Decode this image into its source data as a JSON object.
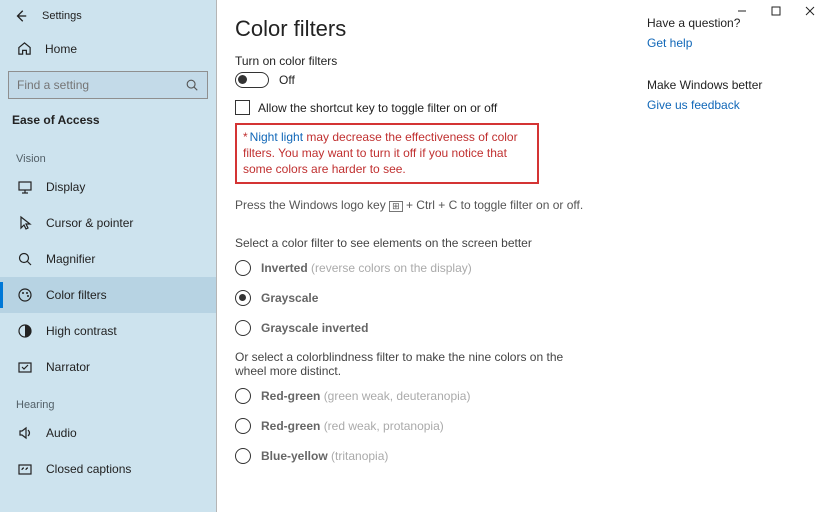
{
  "app": {
    "title": "Settings"
  },
  "sidebar": {
    "home": "Home",
    "search_placeholder": "Find a setting",
    "category": "Ease of Access",
    "sections": [
      {
        "label": "Vision",
        "items": [
          {
            "id": "display",
            "label": "Display",
            "icon": "monitor"
          },
          {
            "id": "cursor-pointer",
            "label": "Cursor & pointer",
            "icon": "cursor"
          },
          {
            "id": "magnifier",
            "label": "Magnifier",
            "icon": "magnify"
          },
          {
            "id": "color-filters",
            "label": "Color filters",
            "icon": "palette",
            "active": true
          },
          {
            "id": "high-contrast",
            "label": "High contrast",
            "icon": "contrast"
          },
          {
            "id": "narrator",
            "label": "Narrator",
            "icon": "narrator"
          }
        ]
      },
      {
        "label": "Hearing",
        "items": [
          {
            "id": "audio",
            "label": "Audio",
            "icon": "speaker"
          },
          {
            "id": "closed-captions",
            "label": "Closed captions",
            "icon": "captions"
          }
        ]
      }
    ]
  },
  "page": {
    "title": "Color filters",
    "toggle_label": "Turn on color filters",
    "toggle_state": "Off",
    "shortcut_check": "Allow the shortcut key to toggle filter on or off",
    "note_asterisk": "*",
    "note_link": "Night light",
    "note_text": " may decrease the effectiveness of color filters. You may want to turn it off if you notice that some colors are harder to see.",
    "key_hint_pre": "Press the Windows logo key ",
    "key_hint_post": " + Ctrl + C to toggle filter on or off.",
    "group1_label": "Select a color filter to see elements on the screen better",
    "radios1": [
      {
        "bold": "Inverted",
        "paren": "(reverse colors on the display)",
        "selected": false
      },
      {
        "bold": "Grayscale",
        "paren": "",
        "selected": true
      },
      {
        "bold": "Grayscale inverted",
        "paren": "",
        "selected": false
      }
    ],
    "group2_label": "Or select a colorblindness filter to make the nine colors on the wheel more distinct.",
    "radios2": [
      {
        "bold": "Red-green",
        "paren": "(green weak, deuteranopia)"
      },
      {
        "bold": "Red-green",
        "paren": "(red weak, protanopia)"
      },
      {
        "bold": "Blue-yellow",
        "paren": "(tritanopia)"
      }
    ]
  },
  "rail": {
    "q_title": "Have a question?",
    "q_link": "Get help",
    "fb_title": "Make Windows better",
    "fb_link": "Give us feedback"
  }
}
